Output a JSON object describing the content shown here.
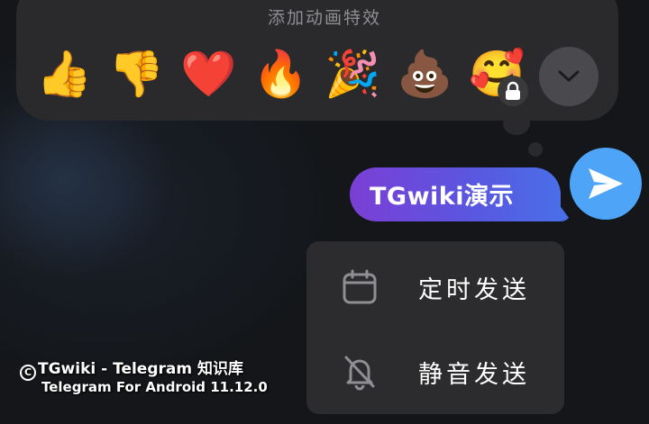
{
  "reaction_panel": {
    "title": "添加动画特效",
    "emojis": [
      {
        "name": "thumbs-up-emoji",
        "glyph": "👍"
      },
      {
        "name": "thumbs-down-emoji",
        "glyph": "👎"
      },
      {
        "name": "red-heart-emoji",
        "glyph": "❤️"
      },
      {
        "name": "fire-emoji",
        "glyph": "🔥"
      },
      {
        "name": "party-popper-emoji",
        "glyph": "🎉"
      },
      {
        "name": "pile-of-poo-emoji",
        "glyph": "💩"
      },
      {
        "name": "smiling-face-with-hearts-emoji",
        "glyph": "🥰"
      }
    ],
    "locked_icon": "lock-icon",
    "expand_icon": "chevron-down-icon"
  },
  "message": {
    "text": "TGwiki演示",
    "bubble_gradient": [
      "#7b3fd4",
      "#4a6ee8"
    ]
  },
  "send_button": {
    "icon": "send-icon",
    "color": "#4ea4f6"
  },
  "send_menu": {
    "items": [
      {
        "label": "定时发送",
        "icon": "calendar-icon"
      },
      {
        "label": "静音发送",
        "icon": "bell-off-icon"
      }
    ]
  },
  "watermark": {
    "mark": "C",
    "line1": "TGwiki - Telegram 知识库",
    "line2": "Telegram For Android 11.12.0"
  }
}
